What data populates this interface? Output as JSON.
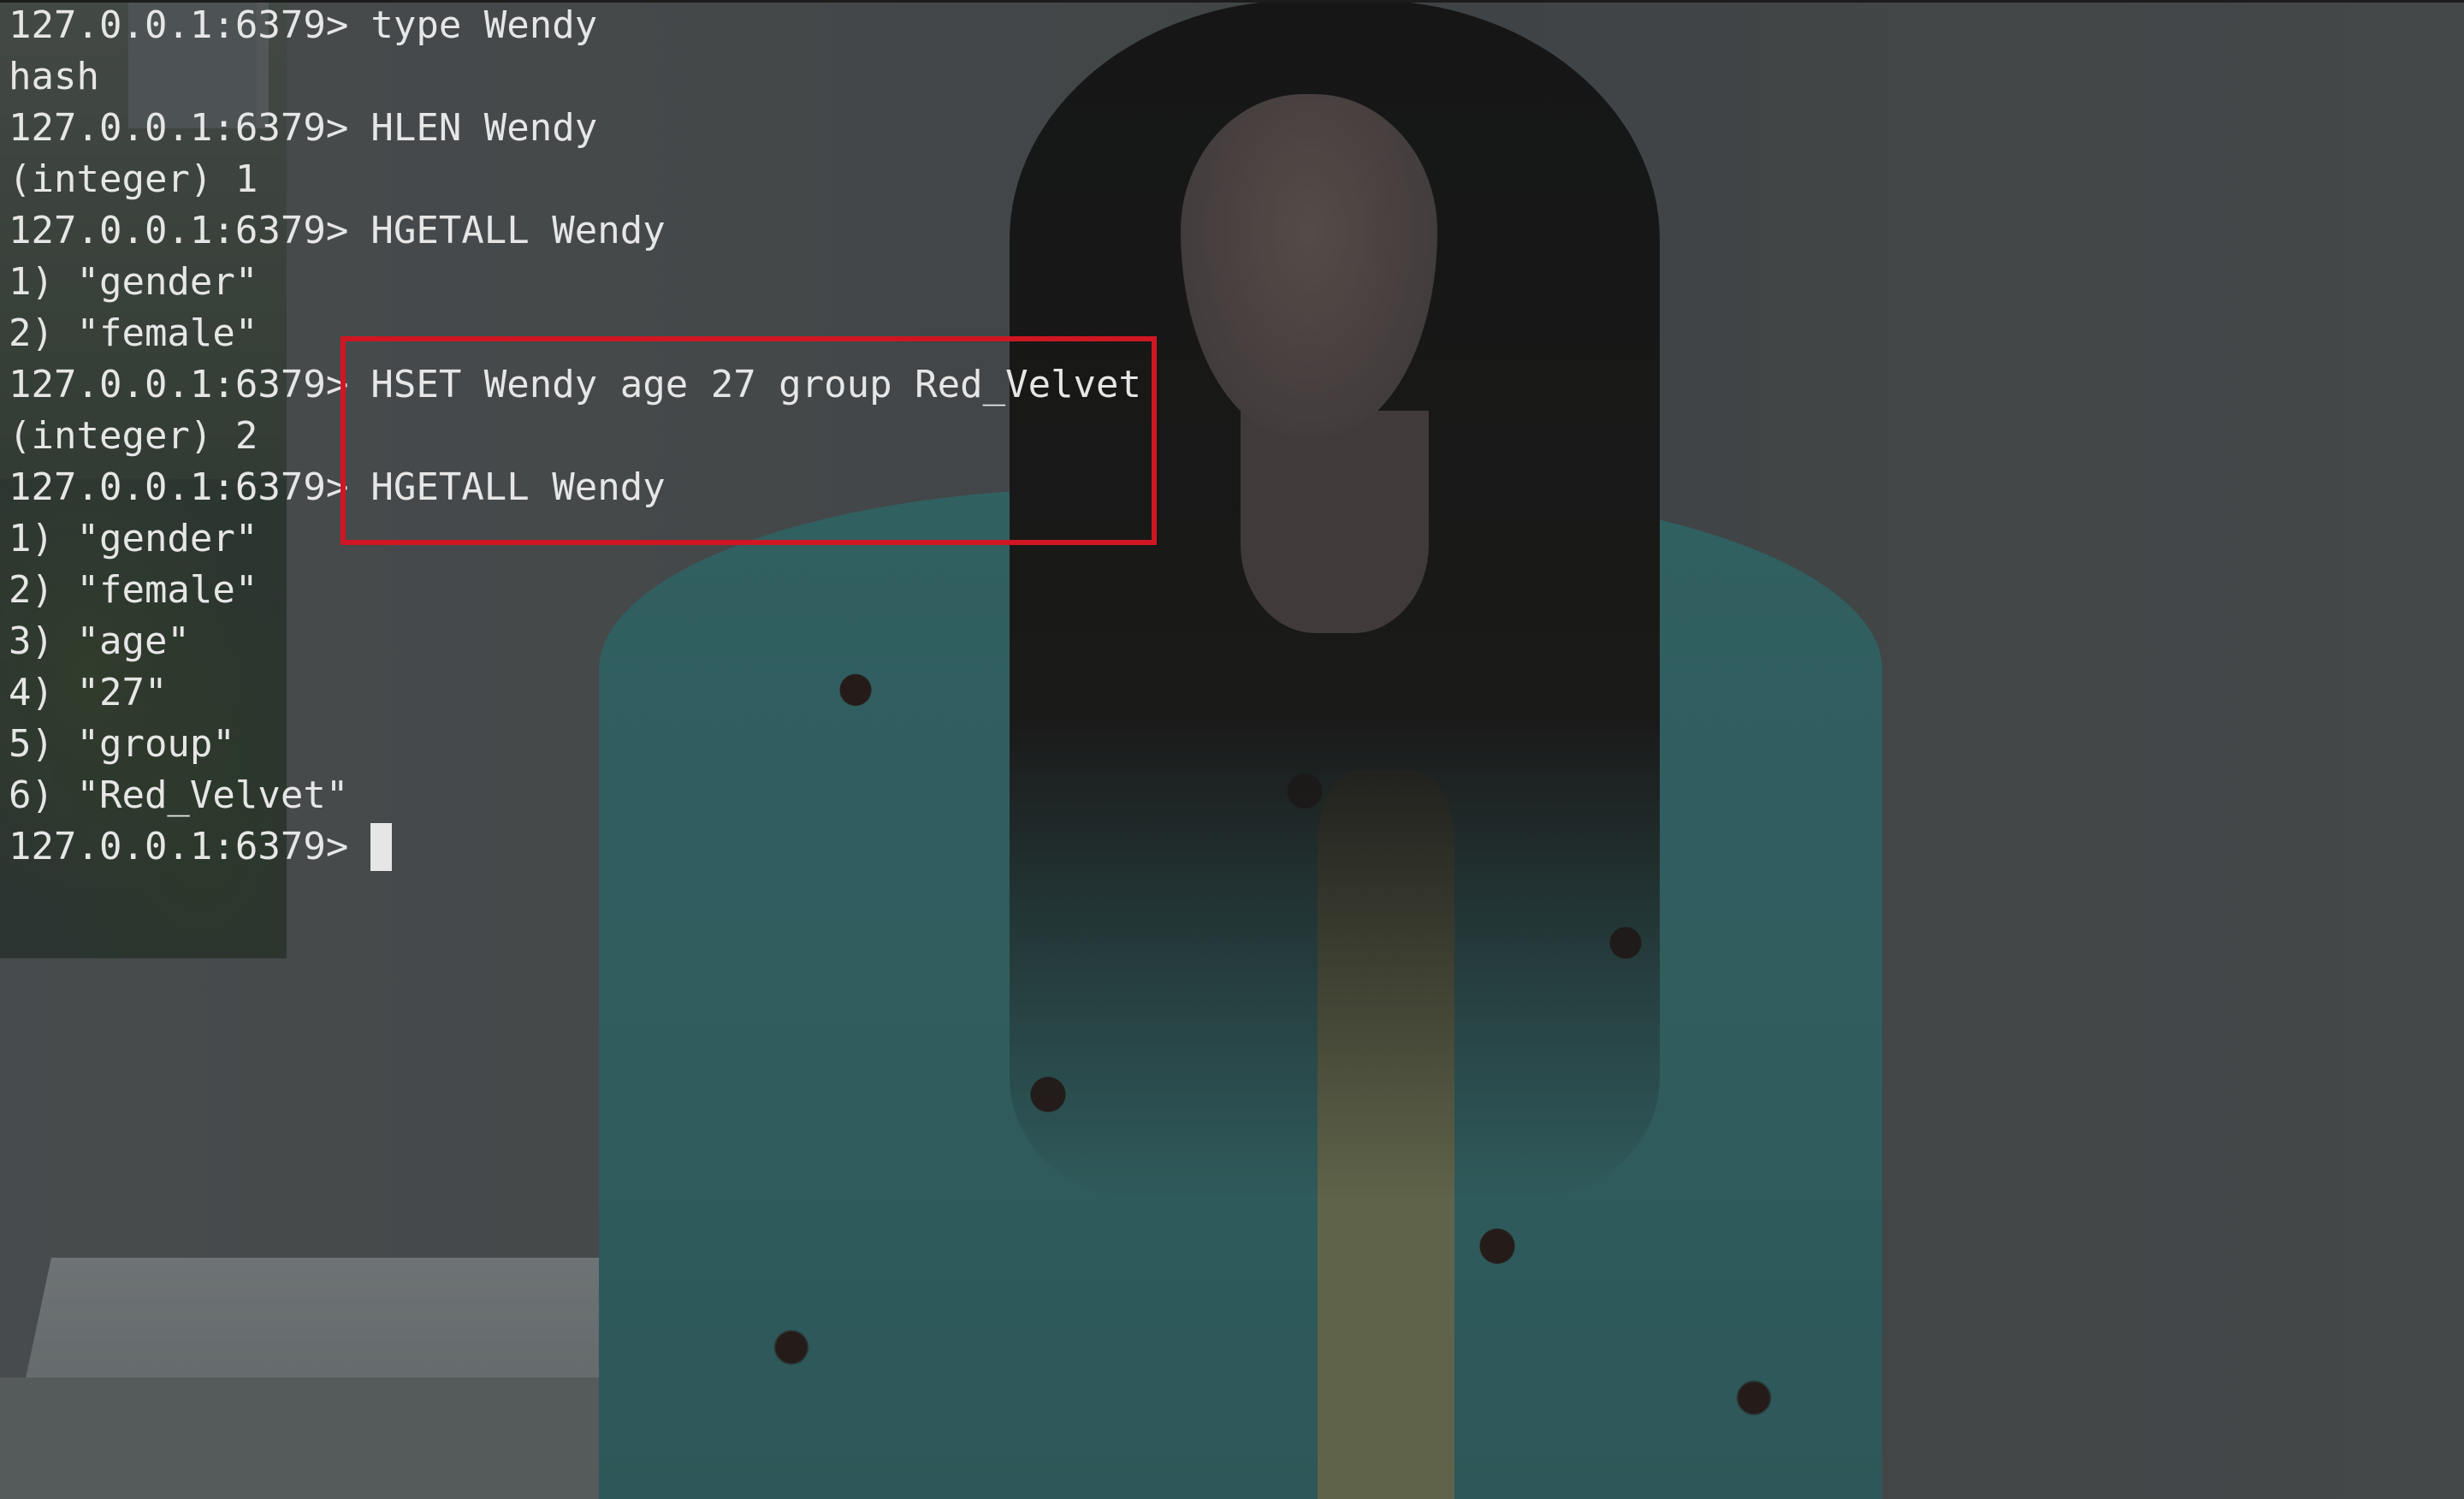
{
  "terminal": {
    "prompt": "127.0.0.1:6379>",
    "lines": [
      {
        "kind": "command",
        "text": "type Wendy"
      },
      {
        "kind": "output",
        "text": "hash"
      },
      {
        "kind": "command",
        "text": "HLEN Wendy"
      },
      {
        "kind": "output",
        "text": "(integer) 1"
      },
      {
        "kind": "command",
        "text": "HGETALL Wendy"
      },
      {
        "kind": "output",
        "text": "1) \"gender\""
      },
      {
        "kind": "output",
        "text": "2) \"female\""
      },
      {
        "kind": "command",
        "text": "HSET Wendy age 27 group Red_Velvet"
      },
      {
        "kind": "output",
        "text": "(integer) 2"
      },
      {
        "kind": "command",
        "text": "HGETALL Wendy"
      },
      {
        "kind": "output",
        "text": "1) \"gender\""
      },
      {
        "kind": "output",
        "text": "2) \"female\""
      },
      {
        "kind": "output",
        "text": "3) \"age\""
      },
      {
        "kind": "output",
        "text": "4) \"27\""
      },
      {
        "kind": "output",
        "text": "5) \"group\""
      },
      {
        "kind": "output",
        "text": "6) \"Red_Velvet\""
      },
      {
        "kind": "command",
        "text": ""
      }
    ],
    "text_color": "#e6e6e6",
    "cursor_icon": "block-cursor-icon"
  },
  "annotation": {
    "color": "#d01622"
  },
  "background": {
    "description_icon": "wallpaper-photo"
  }
}
